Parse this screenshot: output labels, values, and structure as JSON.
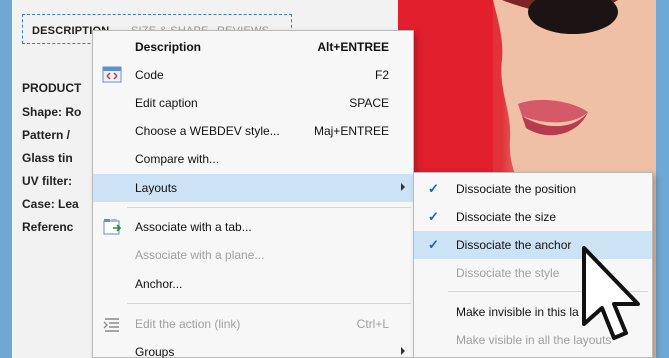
{
  "product": {
    "tabs": [
      "DESCRIPTION",
      "SIZE & SHAPE",
      "REVIEWS"
    ],
    "lines": [
      "PRODUCT",
      "Shape: Ro",
      "Pattern /",
      "Glass tin",
      "UV filter:",
      "Case: Lea",
      "Referenc"
    ]
  },
  "menu": {
    "items": [
      {
        "label": "Description",
        "shortcut": "Alt+ENTREE"
      },
      {
        "label": "Code",
        "shortcut": "F2"
      },
      {
        "label": "Edit caption",
        "shortcut": "SPACE"
      },
      {
        "label": "Choose a WEBDEV style...",
        "shortcut": "Maj+ENTREE"
      },
      {
        "label": "Compare with..."
      },
      {
        "label": "Layouts"
      },
      {
        "label": "Associate with a tab..."
      },
      {
        "label": "Associate with a plane..."
      },
      {
        "label": "Anchor..."
      },
      {
        "label": "Edit the action (link)",
        "shortcut": "Ctrl+L"
      },
      {
        "label": "Groups"
      }
    ]
  },
  "submenu": {
    "items": [
      {
        "label": "Dissociate the position"
      },
      {
        "label": "Dissociate the size"
      },
      {
        "label": "Dissociate the anchor"
      },
      {
        "label": "Dissociate the style"
      },
      {
        "label": "Make invisible in this la"
      },
      {
        "label": "Make visible in all the layouts"
      }
    ]
  },
  "colors": {
    "highlight": "#cce3f5",
    "frame": "#6fa8d4",
    "check": "#1f5fb0"
  },
  "icons": [
    "code-icon",
    "associate-tab-icon",
    "edit-action-icon",
    "checkmark-icon",
    "submenu-arrow-icon",
    "mouse-pointer-icon"
  ]
}
